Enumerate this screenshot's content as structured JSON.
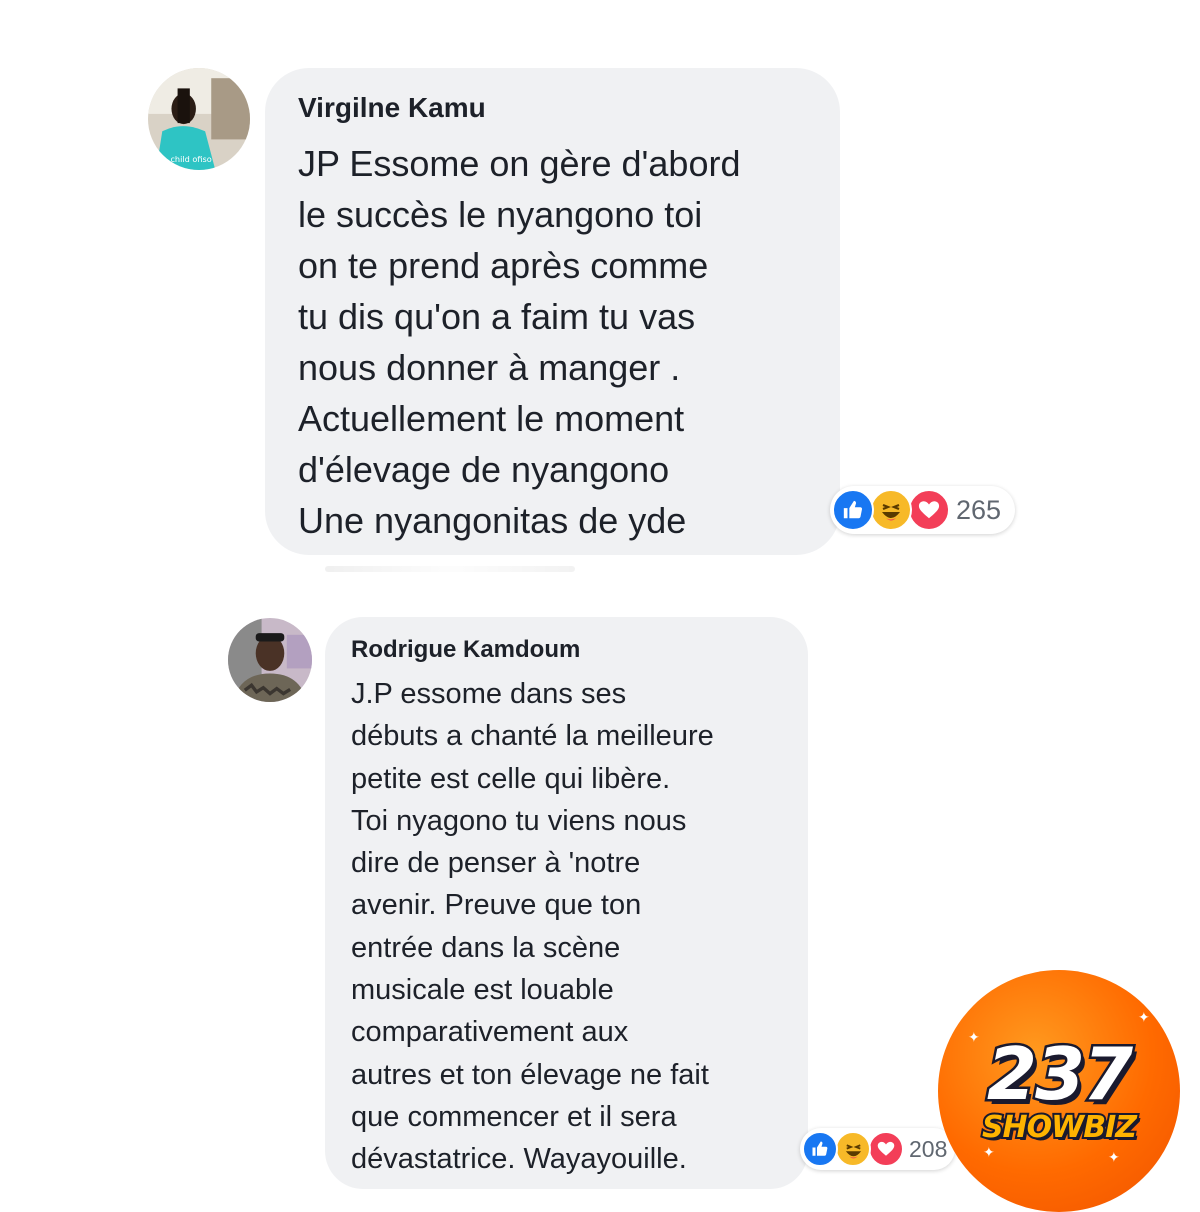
{
  "comments": [
    {
      "author": "Virgilne Kamu",
      "text": "JP Essome on gère d'abord\nle succès le nyangono toi\non te prend après comme\ntu dis qu'on a faim tu vas\nnous donner à manger .\nActuellement le moment\nd'élevage de nyangono\nUne nyangonitas de yde",
      "reaction_count": "265",
      "reactions": [
        "like-icon",
        "haha-icon",
        "love-icon"
      ]
    },
    {
      "author": "Rodrigue Kamdoum",
      "text": "J.P essome dans ses\ndébuts a chanté la meilleure\npetite est celle qui libère.\nToi nyagono tu viens nous\ndire de penser à 'notre\navenir. Preuve que ton\nentrée dans la scène\nmusicale est louable\ncomparativement aux\nautres et ton élevage ne fait\nque commencer et il sera\ndévastatrice. Wayayouille.",
      "reaction_count": "208",
      "reactions": [
        "like-icon",
        "haha-icon",
        "love-icon"
      ]
    }
  ],
  "watermark": {
    "number": "237",
    "word": "SHOWBIZ"
  },
  "colors": {
    "bubble": "#f0f1f3",
    "like": "#1877f2",
    "haha": "#f7b928",
    "love": "#f33e58",
    "logo": "#ff6a00"
  }
}
